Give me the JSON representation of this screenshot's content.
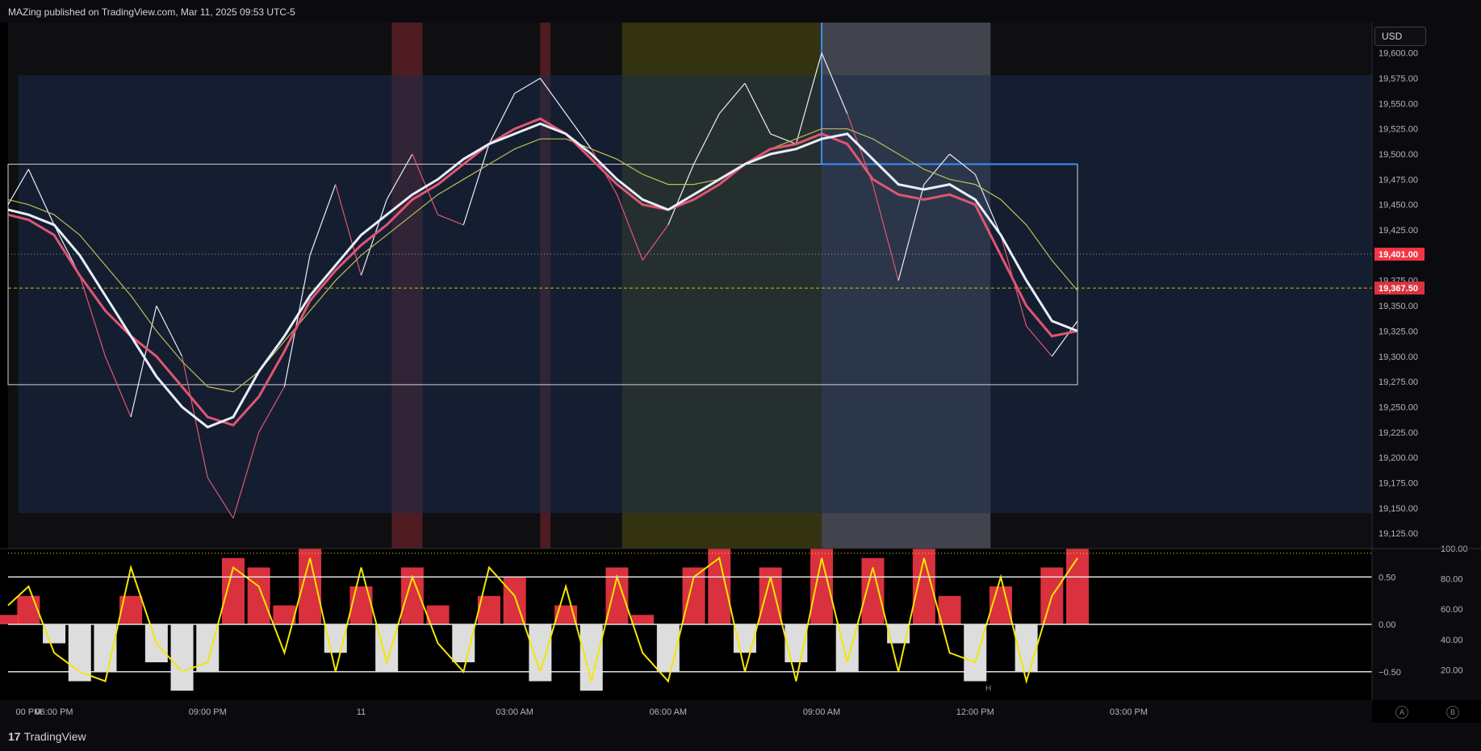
{
  "header": {
    "publisher": "MAZing published on TradingView.com, Mar 11, 2025 09:53 UTC-5"
  },
  "currency_button": "USD",
  "footer": {
    "logo_mark": "17",
    "logo_text": "TradingView"
  },
  "scale_buttons": [
    "A",
    "B"
  ],
  "colors": {
    "bg": "#000000",
    "range_box": "#1b2b48",
    "red_session": "#5a1f26",
    "yellow_session": "#3b3a12",
    "grey_session": "#4a4d57",
    "price_line": "#d9534f",
    "ema_red": "#e05572",
    "ema_white": "#e8eef8",
    "ema_yellow": "#bfbd55",
    "blue_level": "#3d8cff",
    "osc_red": "#f23645",
    "osc_yellow": "#f5e600"
  },
  "chart_data": [
    {
      "type": "line",
      "title": "",
      "xlabel": "",
      "ylabel": "",
      "x_ticks": [
        "00 PM",
        "06:00 PM",
        "09:00 PM",
        "11",
        "03:00 AM",
        "06:00 AM",
        "09:00 AM",
        "12:00 PM",
        "03:00 PM"
      ],
      "x_tick_hours": [
        -0.5,
        0,
        3,
        6,
        9,
        12,
        15,
        18,
        21
      ],
      "ylim": [
        19110,
        19630
      ],
      "y_ticks": [
        19125,
        19150,
        19175,
        19200,
        19225,
        19250,
        19275,
        19300,
        19325,
        19350,
        19375,
        19400,
        19425,
        19450,
        19475,
        19500,
        19525,
        19550,
        19575,
        19600
      ],
      "y_tick_labels": [
        "19,125.00",
        "19,150.00",
        "19,175.00",
        "19,200.00",
        "19,225.00",
        "19,250.00",
        "19,275.00",
        "19,300.00",
        "19,325.00",
        "19,350.00",
        "19,375.00",
        "19,400.00",
        "19,425.00",
        "19,450.00",
        "19,475.00",
        "19,500.00",
        "19,525.00",
        "19,550.00",
        "19,575.00",
        "19,600.00"
      ],
      "last_price": 19401.0,
      "last_price_label": "19,401.00",
      "ref_price": 19367.5,
      "ref_price_label": "19,367.50",
      "series": [
        {
          "x_hours": [
            -0.9,
            -0.5,
            0,
            0.5,
            1,
            1.5,
            2,
            2.5,
            3,
            3.5,
            4,
            4.5,
            5,
            5.5,
            6,
            6.5,
            7,
            7.5,
            8,
            8.5,
            9,
            9.5,
            10,
            10.5,
            11,
            11.5,
            12,
            12.5,
            13,
            13.5,
            14,
            14.5,
            15,
            15.5,
            16,
            16.5,
            17,
            17.5,
            18,
            18.5,
            19,
            19.5,
            20
          ],
          "values": [
            19450,
            19485,
            19430,
            19380,
            19300,
            19240,
            19350,
            19300,
            19180,
            19140,
            19225,
            19270,
            19400,
            19470,
            19380,
            19455,
            19500,
            19440,
            19430,
            19510,
            19560,
            19575,
            19540,
            19505,
            19460,
            19395,
            19430,
            19490,
            19540,
            19570,
            19520,
            19510,
            19600,
            19540,
            19470,
            19375,
            19470,
            19500,
            19480,
            19420,
            19330,
            19300,
            19335
          ]
        }
      ],
      "ema_white": [
        19445,
        19440,
        19430,
        19400,
        19360,
        19320,
        19280,
        19250,
        19230,
        19240,
        19285,
        19320,
        19360,
        19390,
        19420,
        19440,
        19460,
        19475,
        19495,
        19510,
        19520,
        19530,
        19520,
        19500,
        19475,
        19455,
        19445,
        19460,
        19475,
        19490,
        19500,
        19505,
        19515,
        19520,
        19495,
        19470,
        19465,
        19470,
        19455,
        19420,
        19375,
        19335,
        19325
      ],
      "ema_yellow": [
        19455,
        19450,
        19440,
        19420,
        19390,
        19360,
        19325,
        19295,
        19270,
        19265,
        19285,
        19315,
        19345,
        19375,
        19400,
        19420,
        19440,
        19460,
        19475,
        19490,
        19505,
        19515,
        19515,
        19505,
        19495,
        19480,
        19470,
        19470,
        19475,
        19490,
        19505,
        19515,
        19525,
        19525,
        19515,
        19500,
        19485,
        19475,
        19470,
        19455,
        19430,
        19395,
        19365
      ],
      "ema_red": [
        19440,
        19435,
        19420,
        19380,
        19345,
        19320,
        19300,
        19270,
        19240,
        19232,
        19260,
        19305,
        19355,
        19385,
        19410,
        19430,
        19455,
        19470,
        19490,
        19510,
        19525,
        19535,
        19520,
        19495,
        19470,
        19450,
        19445,
        19455,
        19470,
        19490,
        19505,
        19510,
        19520,
        19510,
        19475,
        19460,
        19455,
        19460,
        19450,
        19400,
        19350,
        19320,
        19325
      ],
      "range_box": {
        "x_start": -0.7,
        "x_end": 24,
        "high": 19578,
        "low": 19145
      },
      "opening_range": {
        "x_start": -0.9,
        "x_end": 20,
        "high": 19490,
        "low": 19272
      },
      "sessions": [
        {
          "kind": "red",
          "x_start": 6.6,
          "x_end": 7.2
        },
        {
          "kind": "red",
          "x_start": 9.5,
          "x_end": 9.7
        },
        {
          "kind": "yellow",
          "x_start": 11.1,
          "x_end": 15.0
        },
        {
          "kind": "grey",
          "x_start": 15.0,
          "x_end": 18.3
        }
      ],
      "blue_level": {
        "x_start": 15.0,
        "x_end": 20.0,
        "value": 19490
      }
    },
    {
      "type": "area",
      "title": "",
      "left_axis_labels": [
        "0.50",
        "0.00",
        "−0.50"
      ],
      "left_axis_values": [
        0.5,
        0.0,
        -0.5
      ],
      "right_axis_labels": [
        "100.00",
        "80.00",
        "60.00",
        "40.00",
        "20.00"
      ],
      "right_axis_values": [
        100,
        80,
        60,
        40,
        20
      ],
      "ylim": [
        -0.8,
        0.8
      ],
      "histogram_x_hours": [
        -0.9,
        -0.5,
        0,
        0.5,
        1,
        1.5,
        2,
        2.5,
        3,
        3.5,
        4,
        4.5,
        5,
        5.5,
        6,
        6.5,
        7,
        7.5,
        8,
        8.5,
        9,
        9.5,
        10,
        10.5,
        11,
        11.5,
        12,
        12.5,
        13,
        13.5,
        14,
        14.5,
        15,
        15.5,
        16,
        16.5,
        17,
        17.5,
        18,
        18.5,
        19,
        19.5,
        20
      ],
      "histogram": [
        0.1,
        0.3,
        -0.2,
        -0.6,
        -0.5,
        0.3,
        -0.4,
        -0.7,
        -0.5,
        0.7,
        0.6,
        0.2,
        0.8,
        -0.3,
        0.4,
        -0.5,
        0.6,
        0.2,
        -0.4,
        0.3,
        0.5,
        -0.6,
        0.2,
        -0.7,
        0.6,
        0.1,
        -0.5,
        0.6,
        0.8,
        -0.3,
        0.6,
        -0.4,
        0.8,
        -0.5,
        0.7,
        -0.2,
        0.8,
        0.3,
        -0.6,
        0.4,
        -0.5,
        0.6,
        0.8
      ],
      "signal": [
        0.2,
        0.4,
        -0.3,
        -0.5,
        -0.6,
        0.6,
        -0.2,
        -0.5,
        -0.4,
        0.6,
        0.4,
        -0.3,
        0.7,
        -0.5,
        0.6,
        -0.4,
        0.5,
        -0.2,
        -0.5,
        0.6,
        0.3,
        -0.5,
        0.4,
        -0.6,
        0.5,
        -0.3,
        -0.6,
        0.5,
        0.7,
        -0.5,
        0.5,
        -0.6,
        0.7,
        -0.4,
        0.6,
        -0.5,
        0.7,
        -0.3,
        -0.4,
        0.5,
        -0.6,
        0.3,
        0.7
      ],
      "marker_text": "H"
    }
  ]
}
